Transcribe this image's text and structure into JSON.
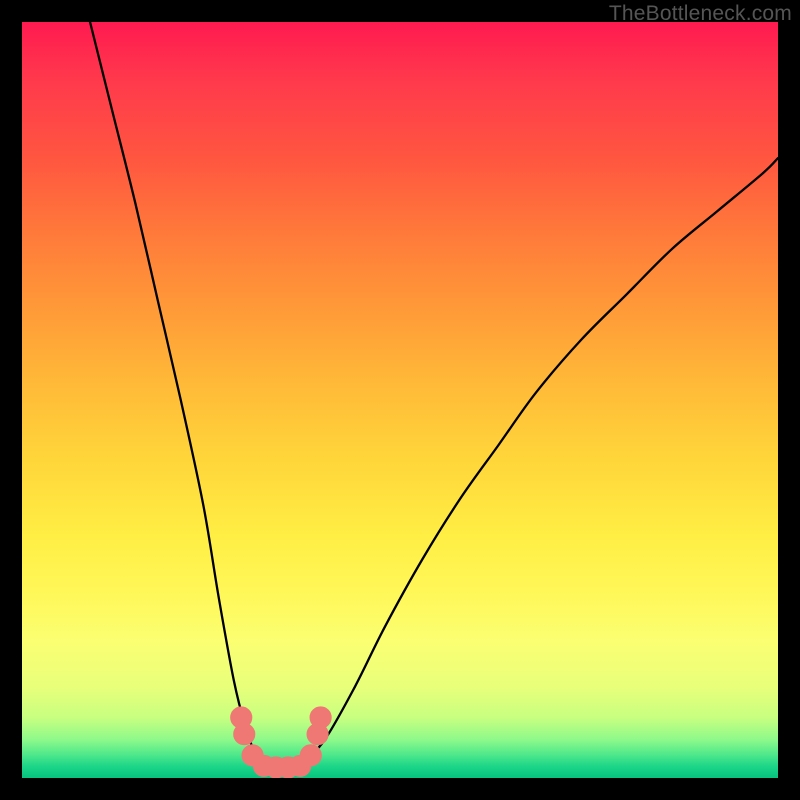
{
  "watermark": "TheBottleneck.com",
  "chart_data": {
    "type": "line",
    "title": "",
    "xlabel": "",
    "ylabel": "",
    "xlim": [
      0,
      100
    ],
    "ylim": [
      0,
      100
    ],
    "series": [
      {
        "name": "curve",
        "x": [
          9,
          12,
          15,
          18,
          21,
          24,
          26,
          28,
          29.5,
          31,
          33,
          35,
          37,
          40,
          44,
          48,
          53,
          58,
          63,
          68,
          74,
          80,
          86,
          92,
          98,
          100
        ],
        "values": [
          100,
          88,
          76,
          63,
          50,
          36,
          24,
          13,
          7,
          3,
          1,
          1,
          2,
          5,
          12,
          20,
          29,
          37,
          44,
          51,
          58,
          64,
          70,
          75,
          80,
          82
        ]
      }
    ],
    "markers": [
      {
        "cx": 29.0,
        "cy": 8.0,
        "r": 1.4
      },
      {
        "cx": 29.4,
        "cy": 5.8,
        "r": 1.4
      },
      {
        "cx": 30.5,
        "cy": 3.0,
        "r": 1.4
      },
      {
        "cx": 32.0,
        "cy": 1.6,
        "r": 1.4
      },
      {
        "cx": 33.6,
        "cy": 1.4,
        "r": 1.4
      },
      {
        "cx": 35.2,
        "cy": 1.4,
        "r": 1.4
      },
      {
        "cx": 36.8,
        "cy": 1.6,
        "r": 1.4
      },
      {
        "cx": 38.2,
        "cy": 3.0,
        "r": 1.4
      },
      {
        "cx": 39.1,
        "cy": 5.8,
        "r": 1.4
      },
      {
        "cx": 39.5,
        "cy": 8.0,
        "r": 1.4
      }
    ],
    "gradient_map": [
      {
        "stop": 0,
        "color": "#ff1a50",
        "meaning": "worst"
      },
      {
        "stop": 0.5,
        "color": "#ffd63a",
        "meaning": "mid"
      },
      {
        "stop": 1.0,
        "color": "#06c37e",
        "meaning": "best"
      }
    ]
  }
}
